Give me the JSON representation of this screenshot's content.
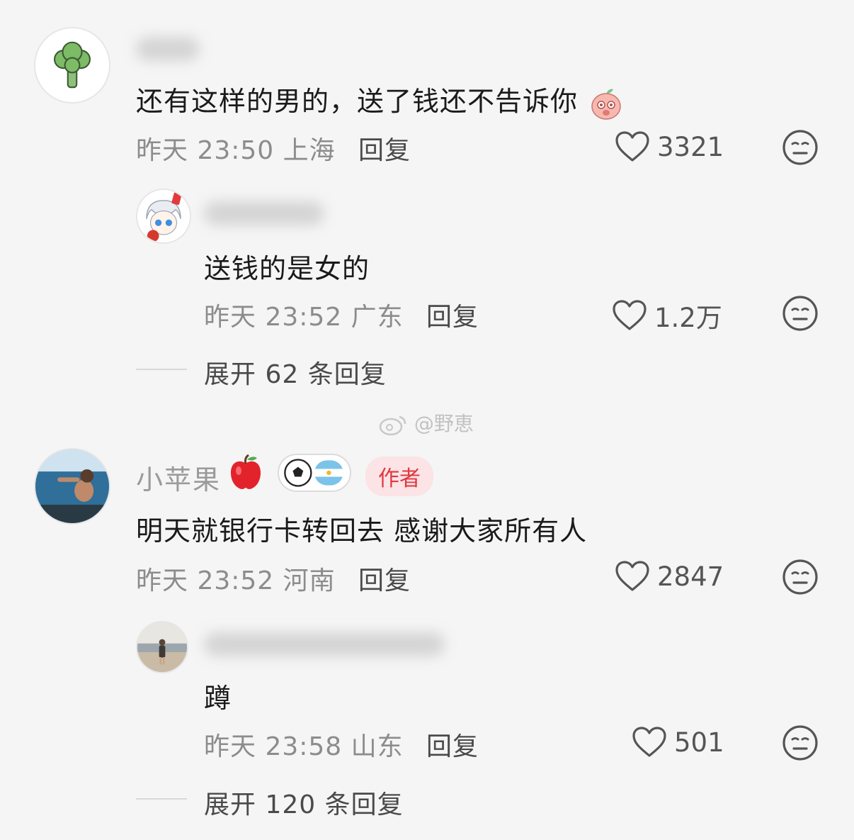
{
  "comments": [
    {
      "avatar_icon": "broccoli-icon",
      "text": "还有这样的男的，送了钱还不告诉你",
      "emoji": "peach-shy-emoji-icon",
      "date": "昨天",
      "time": "23:50",
      "location": "上海",
      "reply_label": "回复",
      "likes": "3321",
      "replies": [
        {
          "avatar_icon": "anime-boy-red-card-icon",
          "text": "送钱的是女的",
          "date": "昨天",
          "time": "23:52",
          "location": "广东",
          "reply_label": "回复",
          "likes": "1.2万"
        }
      ],
      "expand_label": "展开 62 条回复"
    },
    {
      "avatar_icon": "beach-photo-avatar",
      "nickname": "小苹果",
      "nickname_emoji": "apple-icon",
      "fan_badge_icon": "football-argentina-flag-icon",
      "author_badge": "作者",
      "text": "明天就银行卡转回去 感谢大家所有人",
      "date": "昨天",
      "time": "23:52",
      "location": "河南",
      "reply_label": "回复",
      "likes": "2847",
      "replies": [
        {
          "avatar_icon": "seaside-photo-avatar",
          "text": "蹲",
          "date": "昨天",
          "time": "23:58",
          "location": "山东",
          "reply_label": "回复",
          "likes": "501"
        }
      ],
      "expand_label": "展开 120 条回复"
    }
  ],
  "watermark": "@野恵",
  "colors": {
    "background": "#f5f5f5",
    "author_badge_bg": "#fbe3e6",
    "author_badge_text": "#e0383e"
  }
}
